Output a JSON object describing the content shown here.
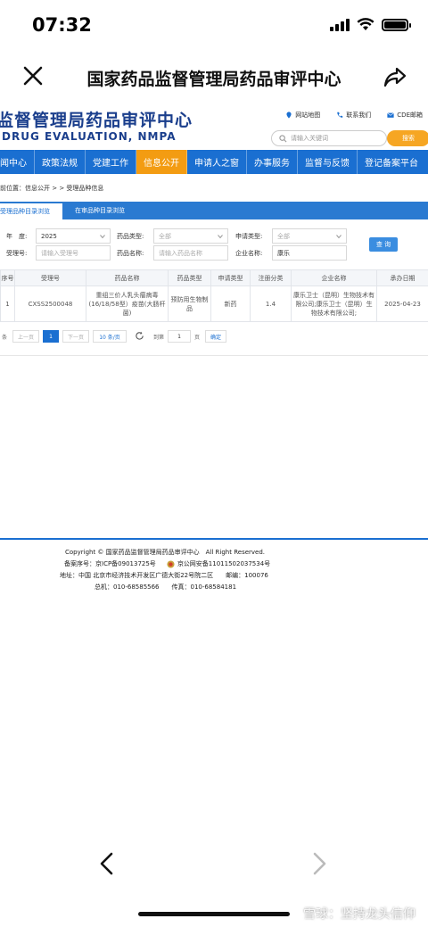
{
  "status_bar": {
    "time": "07:32"
  },
  "nav_bar": {
    "title": "国家药品监督管理局药品审评中心"
  },
  "site": {
    "name_cn": "监督管理局药品审评中心",
    "name_en": "DRUG EVALUATION, NMPA",
    "top_links": [
      "网站地图",
      "联系我们",
      "CDE邮箱"
    ],
    "search_placeholder": "请输入关键词",
    "search_button": "搜索"
  },
  "menu": {
    "items": [
      "闻中心",
      "政策法规",
      "党建工作",
      "信息公开",
      "申请人之窗",
      "办事服务",
      "监督与反馈",
      "登记备案平台"
    ],
    "active_index": 3
  },
  "breadcrumb": "前位置：信息公开 > > 受理品种信息",
  "subtabs": [
    "受理品种目录浏览",
    "在审品种目录浏览"
  ],
  "filters": {
    "year_label": "年　度:",
    "year_value": "2025",
    "drug_type_label": "药品类型:",
    "drug_type_value": "全部",
    "apply_type_label": "申请类型:",
    "apply_type_value": "全部",
    "accept_no_label": "受理号:",
    "accept_no_placeholder": "请输入受理号",
    "drug_name_label": "药品名称:",
    "drug_name_placeholder": "请输入药品名称",
    "company_label": "企业名称:",
    "company_value": "康乐",
    "query_button": "查 询"
  },
  "table": {
    "headers": [
      "序号",
      "受理号",
      "药品名称",
      "药品类型",
      "申请类型",
      "注册分类",
      "企业名称",
      "承办日期"
    ],
    "rows": [
      {
        "index": "1",
        "accept_no": "CXSS2500048",
        "drug_name": "重组三价人乳头瘤病毒(16/18/58型）疫苗(大肠杆菌)",
        "drug_type": "预防用生物制品",
        "apply_type": "新药",
        "reg_class": "1.4",
        "company": "康乐卫士（昆明）生物技术有限公司;康乐卫士（昆明）生物技术有限公司;",
        "date": "2025-04-23"
      }
    ]
  },
  "pager": {
    "total_suffix": "条",
    "prev": "上一页",
    "current": "1",
    "next": "下一页",
    "page_size": "10 条/页",
    "goto_label": "到第",
    "goto_value": "1",
    "page_suffix": "页",
    "confirm": "确定"
  },
  "footer": {
    "copyright": "Copyright © 国家药品监督管理局药品审评中心　All Right Reserved.",
    "icp_label": "备案序号：京ICP备09013725号",
    "police": "京公网安备11011502037534号",
    "address": "地址：中国 北京市经济技术开发区广德大街22号院二区　　邮编：100076",
    "phones": "总机：010-68585566　　传真：010-68584181"
  },
  "watermark": "雪球：坚持龙头信仰"
}
